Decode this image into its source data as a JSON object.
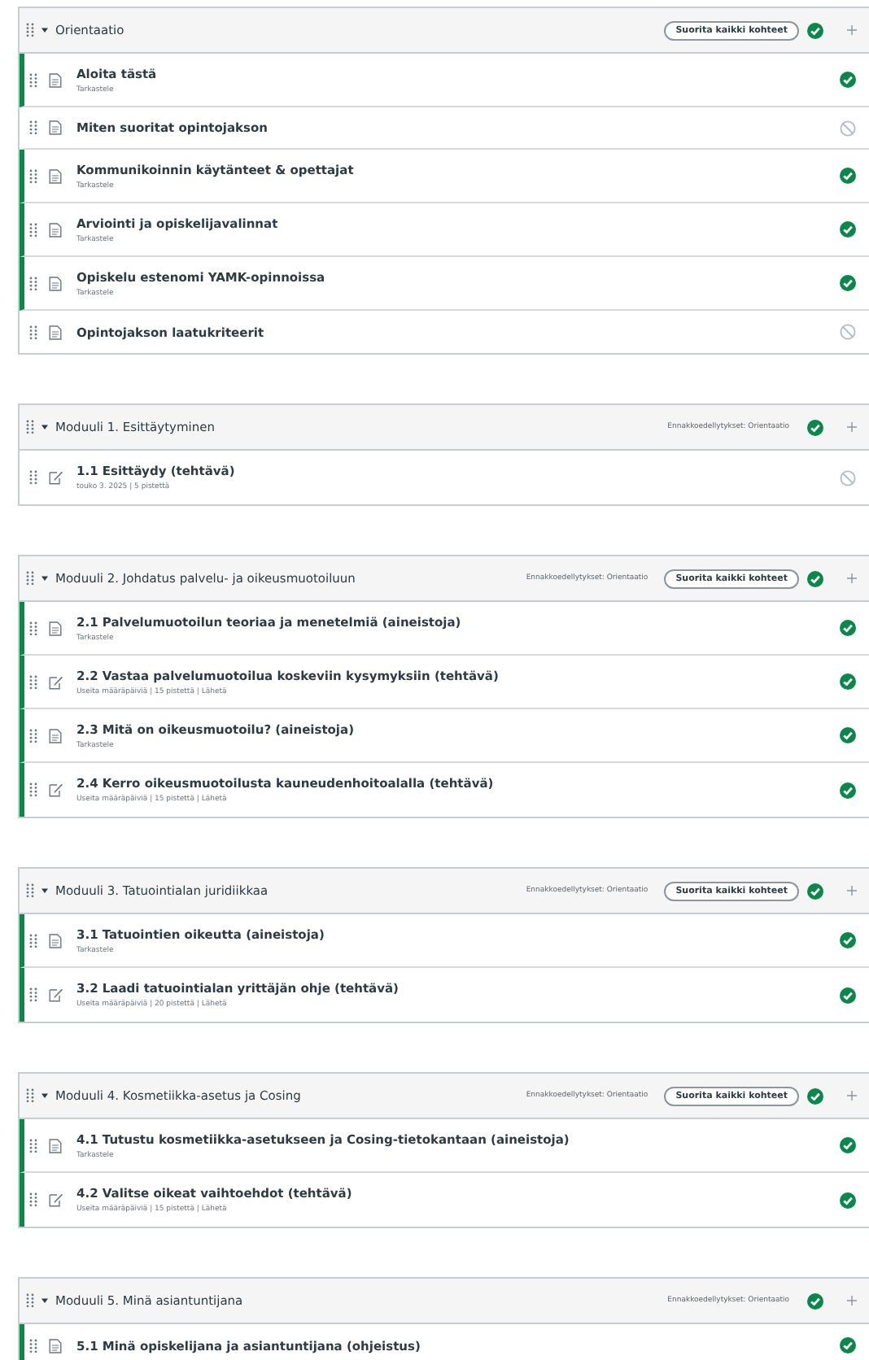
{
  "modules": [
    {
      "title": "Orientaatio",
      "expanded": true,
      "complete_all": "Suorita kaikki kohteet",
      "published": true,
      "items": [
        {
          "kind": "page",
          "title": "Aloita tästä",
          "meta": "Tarkastele",
          "published": true
        },
        {
          "kind": "page",
          "title": "Miten suoritat opintojakson",
          "published": false
        },
        {
          "kind": "page",
          "title": "Kommunikoinnin käytänteet & opettajat",
          "meta": "Tarkastele",
          "published": true
        },
        {
          "kind": "page",
          "title": "Arviointi ja opiskelijavalinnat",
          "meta": "Tarkastele",
          "published": true
        },
        {
          "kind": "page",
          "title": "Opiskelu estenomi YAMK-opinnoissa",
          "meta": "Tarkastele",
          "published": true
        },
        {
          "kind": "page",
          "title": "Opintojakson laatukriteerit",
          "published": false
        }
      ]
    },
    {
      "title": "Moduuli 1. Esittäytyminen",
      "expanded": true,
      "prerequisites": "Ennakkoedellytykset: Orientaatio",
      "published": true,
      "items": [
        {
          "kind": "assignment",
          "title": "1.1 Esittäydy (tehtävä)",
          "meta": "touko 3. 2025 | 5 pistettä",
          "published": false
        }
      ]
    },
    {
      "title": "Moduuli 2. Johdatus palvelu- ja oikeusmuotoiluun",
      "expanded": true,
      "prerequisites": "Ennakkoedellytykset: Orientaatio",
      "complete_all": "Suorita kaikki kohteet",
      "published": true,
      "items": [
        {
          "kind": "page",
          "title": "2.1 Palvelumuotoilun teoriaa ja menetelmiä (aineistoja)",
          "meta": "Tarkastele",
          "published": true
        },
        {
          "kind": "assignment",
          "title": "2.2 Vastaa palvelumuotoilua koskeviin kysymyksiin (tehtävä)",
          "meta": "Useita määräpäiviä | 15 pistettä | Lähetä",
          "published": true
        },
        {
          "kind": "page",
          "title": "2.3 Mitä on oikeusmuotoilu? (aineistoja)",
          "meta": "Tarkastele",
          "published": true
        },
        {
          "kind": "assignment",
          "title": "2.4 Kerro oikeusmuotoilusta kauneudenhoitoalalla (tehtävä)",
          "meta": "Useita määräpäiviä | 15 pistettä | Lähetä",
          "published": true
        }
      ]
    },
    {
      "title": "Moduuli 3. Tatuointialan juridiikkaa",
      "expanded": true,
      "prerequisites": "Ennakkoedellytykset: Orientaatio",
      "complete_all": "Suorita kaikki kohteet",
      "published": true,
      "items": [
        {
          "kind": "page",
          "title": "3.1 Tatuointien oikeutta (aineistoja)",
          "meta": "Tarkastele",
          "published": true
        },
        {
          "kind": "assignment",
          "title": "3.2 Laadi tatuointialan yrittäjän ohje (tehtävä)",
          "meta": "Useita määräpäiviä | 20 pistettä | Lähetä",
          "published": true
        }
      ]
    },
    {
      "title": "Moduuli 4. Kosmetiikka-asetus ja Cosing",
      "expanded": true,
      "prerequisites": "Ennakkoedellytykset: Orientaatio",
      "complete_all": "Suorita kaikki kohteet",
      "published": true,
      "items": [
        {
          "kind": "page",
          "title": "4.1 Tutustu kosmetiikka-asetukseen ja Cosing-tietokantaan (aineistoja)",
          "meta": "Tarkastele",
          "published": true
        },
        {
          "kind": "assignment",
          "title": "4.2 Valitse oikeat vaihtoehdot (tehtävä)",
          "meta": "Useita määräpäiviä | 15 pistettä | Lähetä",
          "published": true
        }
      ]
    },
    {
      "title": "Moduuli 5. Minä asiantuntijana",
      "expanded": true,
      "prerequisites": "Ennakkoedellytykset: Orientaatio",
      "published": true,
      "items": [
        {
          "kind": "page",
          "title": "5.1 Minä opiskelijana ja asiantuntijana (ohjeistus)",
          "published": true
        }
      ]
    }
  ]
}
